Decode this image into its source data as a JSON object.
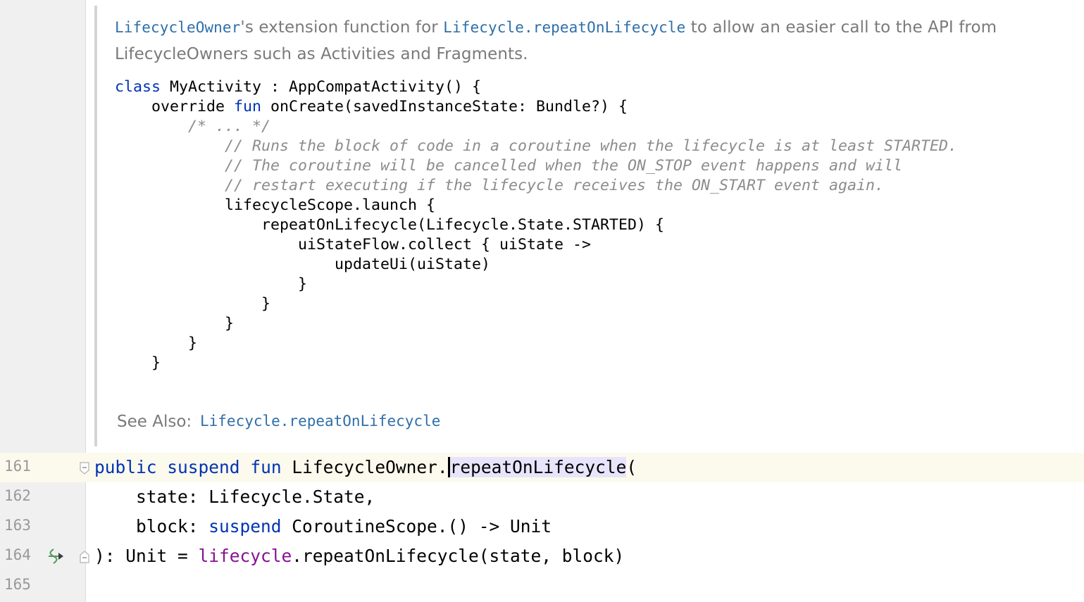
{
  "doc": {
    "intro": {
      "link1": "LifecycleOwner",
      "text1": "'s extension function for ",
      "link2": "Lifecycle.repeatOnLifecycle",
      "text2": " to allow an easier call to the API from LifecycleOwners such as Activities and Fragments."
    },
    "code_sample": {
      "l1_kw": "class",
      "l1_rest": " MyActivity : AppCompatActivity() {",
      "l2_indent": "    override ",
      "l2_kw": "fun",
      "l2_rest": " onCreate(savedInstanceState: Bundle?) {",
      "l3": "        /* ... */",
      "l4": "            // Runs the block of code in a coroutine when the lifecycle is at least STARTED.",
      "l5": "            // The coroutine will be cancelled when the ON_STOP event happens and will",
      "l6": "            // restart executing if the lifecycle receives the ON_START event again.",
      "l7": "            lifecycleScope.launch {",
      "l8": "                repeatOnLifecycle(Lifecycle.State.STARTED) {",
      "l9": "                    uiStateFlow.collect { uiState ->",
      "l10": "                        updateUi(uiState)",
      "l11": "                    }",
      "l12": "                }",
      "l13": "            }",
      "l14": "        }",
      "l15": "    }"
    },
    "see_also_label": "See Also:",
    "see_also_link": "Lifecycle.repeatOnLifecycle"
  },
  "editor": {
    "lines": [
      {
        "number": "161",
        "kw1": "public",
        "kw2": "suspend",
        "kw3": "fun",
        "text_a": " LifecycleOwner.",
        "selected": "repeatOnLifecycle",
        "text_b": "("
      },
      {
        "number": "162",
        "text": "    state: Lifecycle.State,"
      },
      {
        "number": "163",
        "text_a": "    block: ",
        "kw": "suspend",
        "text_b": " CoroutineScope.() -> Unit"
      },
      {
        "number": "164",
        "text_a": "): Unit = ",
        "prop": "lifecycle",
        "text_b": ".repeatOnLifecycle(state, block)"
      },
      {
        "number": "165"
      }
    ]
  },
  "icons": {
    "fold_top": "fold-collapse-icon",
    "fold_bottom": "fold-end-icon",
    "implements": "implements-arrow-icon"
  },
  "colors": {
    "keyword": "#0033b3",
    "doc_link": "#2e6fa8",
    "property": "#871094",
    "comment": "#8c8c8c",
    "current_line": "#fcfaed",
    "selection": "#e8e4fb"
  }
}
